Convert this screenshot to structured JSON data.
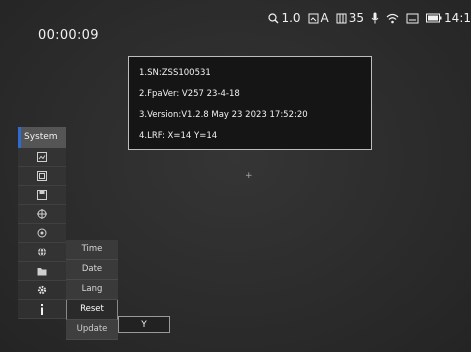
{
  "status": {
    "zoom_icon": "zoom-icon",
    "zoom": "1.0",
    "mode_icon": "image-mode-icon",
    "mode": "A",
    "battery_count_icon": "card-icon",
    "count": "35",
    "mic_icon": "mic-icon",
    "wifi_icon": "wifi-icon",
    "storage_icon": "storage-icon",
    "battery_icon": "battery-icon",
    "time": "14:1"
  },
  "timer": "00:00:09",
  "info": {
    "sn": "1.SN:ZSS100531",
    "fpa": "2.FpaVer: V257  23-4-18",
    "version": "3.Version:V1.2.8  May  23  2023  17:52:20",
    "lrf": "4.LRF:  X=14  Y=14"
  },
  "crosshair": "+",
  "sidebar": {
    "title": "System",
    "icons": [
      "image-icon",
      "palette-icon",
      "save-icon",
      "crosshair-settings-icon",
      "target-icon",
      "globe-icon",
      "folder-icon",
      "gear-icon",
      "info-icon"
    ]
  },
  "submenu": {
    "items": [
      "Time",
      "Date",
      "Lang",
      "Reset",
      "Update"
    ],
    "selected": "Reset",
    "value": "Y"
  }
}
